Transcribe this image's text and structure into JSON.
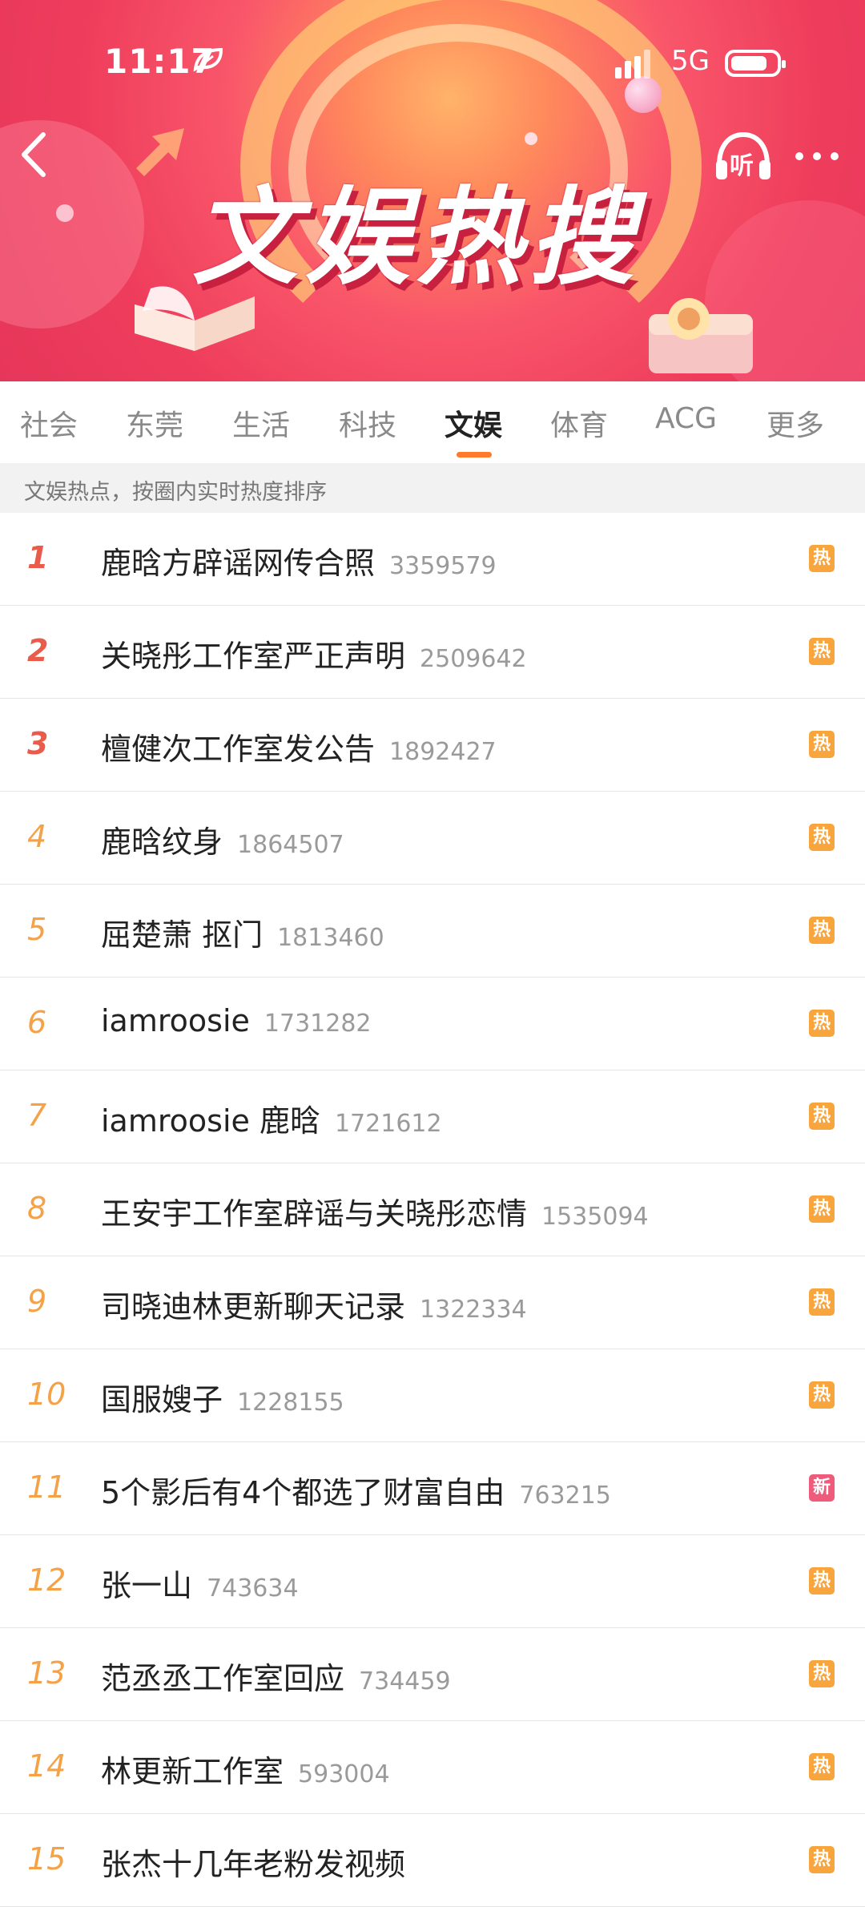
{
  "status_bar": {
    "time": "11:17",
    "network": "5G"
  },
  "header": {
    "title": "文娱热搜",
    "listen_label": "听"
  },
  "tabs": [
    {
      "label": "社会"
    },
    {
      "label": "东莞"
    },
    {
      "label": "生活"
    },
    {
      "label": "科技"
    },
    {
      "label": "文娱",
      "active": true
    },
    {
      "label": "体育"
    },
    {
      "label": "ACG"
    },
    {
      "label": "更多"
    }
  ],
  "notice": "文娱热点，按圈内实时热度排序",
  "items": [
    {
      "rank": "1",
      "title": "鹿晗方辟谣网传合照",
      "count": "3359579",
      "badge": "热"
    },
    {
      "rank": "2",
      "title": "关晓彤工作室严正声明",
      "count": "2509642",
      "badge": "热"
    },
    {
      "rank": "3",
      "title": "檀健次工作室发公告",
      "count": "1892427",
      "badge": "热"
    },
    {
      "rank": "4",
      "title": "鹿晗纹身",
      "count": "1864507",
      "badge": "热"
    },
    {
      "rank": "5",
      "title": "屈楚萧 抠门",
      "count": "1813460",
      "badge": "热"
    },
    {
      "rank": "6",
      "title": "iamroosie",
      "count": "1731282",
      "badge": "热"
    },
    {
      "rank": "7",
      "title": "iamroosie 鹿晗",
      "count": "1721612",
      "badge": "热"
    },
    {
      "rank": "8",
      "title": "王安宇工作室辟谣与关晓彤恋情",
      "count": "1535094",
      "badge": "热"
    },
    {
      "rank": "9",
      "title": "司晓迪林更新聊天记录",
      "count": "1322334",
      "badge": "热"
    },
    {
      "rank": "10",
      "title": "国服嫂子",
      "count": "1228155",
      "badge": "热"
    },
    {
      "rank": "11",
      "title": "5个影后有4个都选了财富自由",
      "count": "763215",
      "badge": "新"
    },
    {
      "rank": "12",
      "title": "张一山",
      "count": "743634",
      "badge": "热"
    },
    {
      "rank": "13",
      "title": "范丞丞工作室回应",
      "count": "734459",
      "badge": "热"
    },
    {
      "rank": "14",
      "title": "林更新工作室",
      "count": "593004",
      "badge": "热"
    },
    {
      "rank": "15",
      "title": "张杰十几年老粉发视频",
      "count": "",
      "badge": "热"
    }
  ],
  "colors": {
    "accent": "#ff7a2b",
    "hot_badge": "#f7a53c",
    "new_badge": "#ef5b7a",
    "top_rank": "#ea5b4b",
    "rank": "#f5a146"
  }
}
